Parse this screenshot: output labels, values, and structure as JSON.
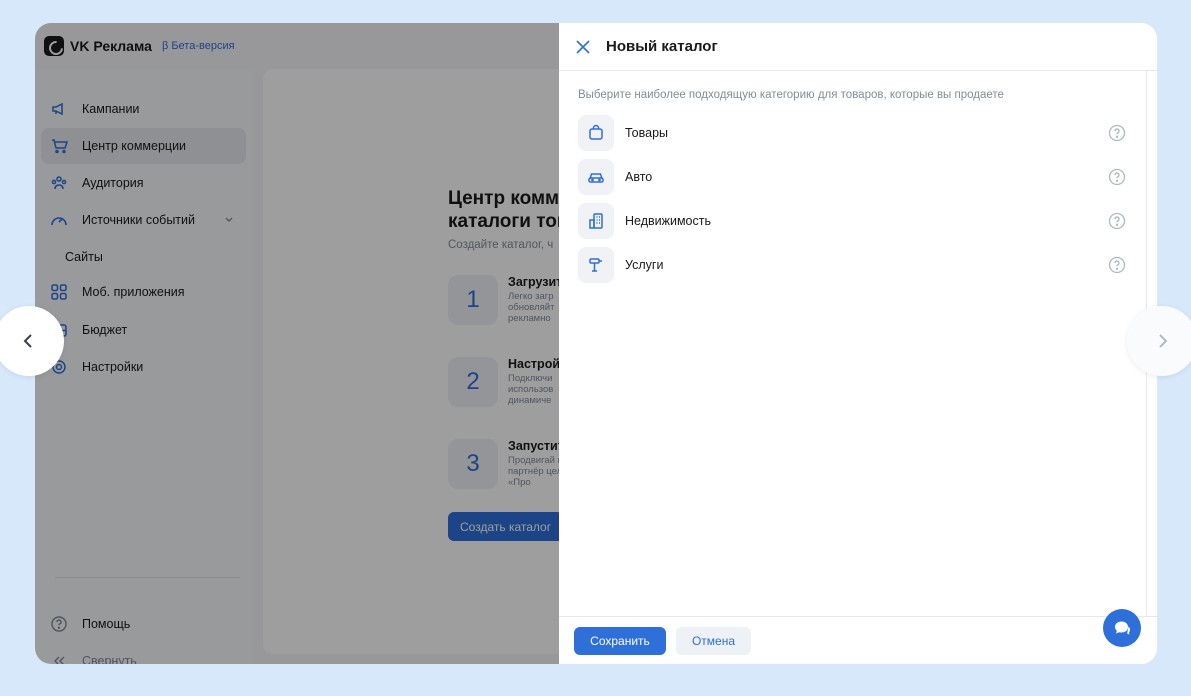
{
  "app": {
    "brand": "VK Реклама",
    "beta_label": "β Бета-версия"
  },
  "sidebar": {
    "items": [
      {
        "label": "Кампании",
        "icon": "megaphone-icon"
      },
      {
        "label": "Центр коммерции",
        "icon": "cart-icon",
        "active": true
      },
      {
        "label": "Аудитория",
        "icon": "audience-icon"
      },
      {
        "label": "Источники событий",
        "icon": "gauge-icon",
        "expandable": true
      },
      {
        "label": "Сайты",
        "sub": true
      },
      {
        "label": "Моб. приложения",
        "icon": "apps-icon"
      },
      {
        "label": "Бюджет",
        "icon": "wallet-icon"
      },
      {
        "label": "Настройки",
        "icon": "gear-icon"
      }
    ],
    "help_label": "Помощь",
    "collapse_label": "Свернуть"
  },
  "main": {
    "title": "Центр комме каталоги тов",
    "subtitle": "Создайте каталог, ч",
    "steps": [
      {
        "num": "1",
        "title": "Загрузит",
        "desc": "Легко загр обновляйт рекламно"
      },
      {
        "num": "2",
        "title": "Настройт",
        "desc": "Подключи использов динамиче"
      },
      {
        "num": "3",
        "title": "Запустит",
        "desc": "Продвигай и партнёр цель «Про"
      }
    ],
    "create_button": "Создать каталог"
  },
  "panel": {
    "title": "Новый каталог",
    "hint": "Выберите наиболее подходящую категорию для товаров, которые вы продаете",
    "categories": [
      {
        "label": "Товары",
        "icon": "bag-icon"
      },
      {
        "label": "Авто",
        "icon": "car-icon"
      },
      {
        "label": "Недвижимость",
        "icon": "building-icon"
      },
      {
        "label": "Услуги",
        "icon": "service-icon"
      }
    ],
    "save_button": "Сохранить",
    "cancel_button": "Отмена"
  },
  "colors": {
    "accent": "#2e6fd9",
    "page_bg": "#d7e8fb"
  }
}
